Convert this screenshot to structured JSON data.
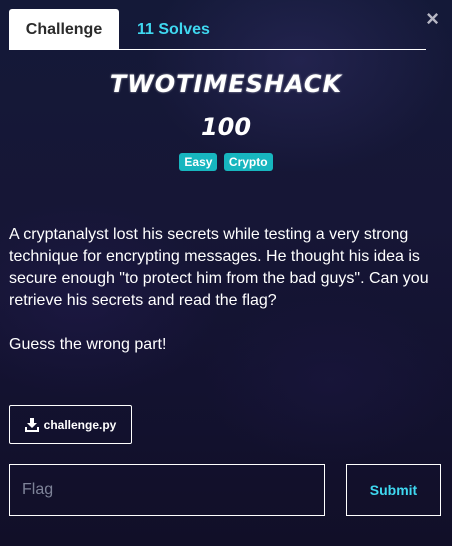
{
  "tabs": {
    "challenge_label": "Challenge",
    "solves_label": "11 Solves"
  },
  "close_glyph": "×",
  "challenge": {
    "name": "TWOTIMESHACK",
    "points": "100",
    "tags": [
      "Easy",
      "Crypto"
    ],
    "description": [
      "A cryptanalyst lost his secrets while testing a very strong technique for encrypting messages. He thought his idea is secure enough \"to protect him from the bad guys\". Can you retrieve his secrets and read the flag?",
      "Guess the wrong part!"
    ],
    "file_label": "challenge.py"
  },
  "form": {
    "flag_placeholder": "Flag",
    "submit_label": "Submit"
  },
  "colors": {
    "accent": "#3fd8f0",
    "tag_bg": "#17b6bf",
    "background": "#141938"
  },
  "icons": {
    "close": "close-icon",
    "download": "download-icon"
  }
}
